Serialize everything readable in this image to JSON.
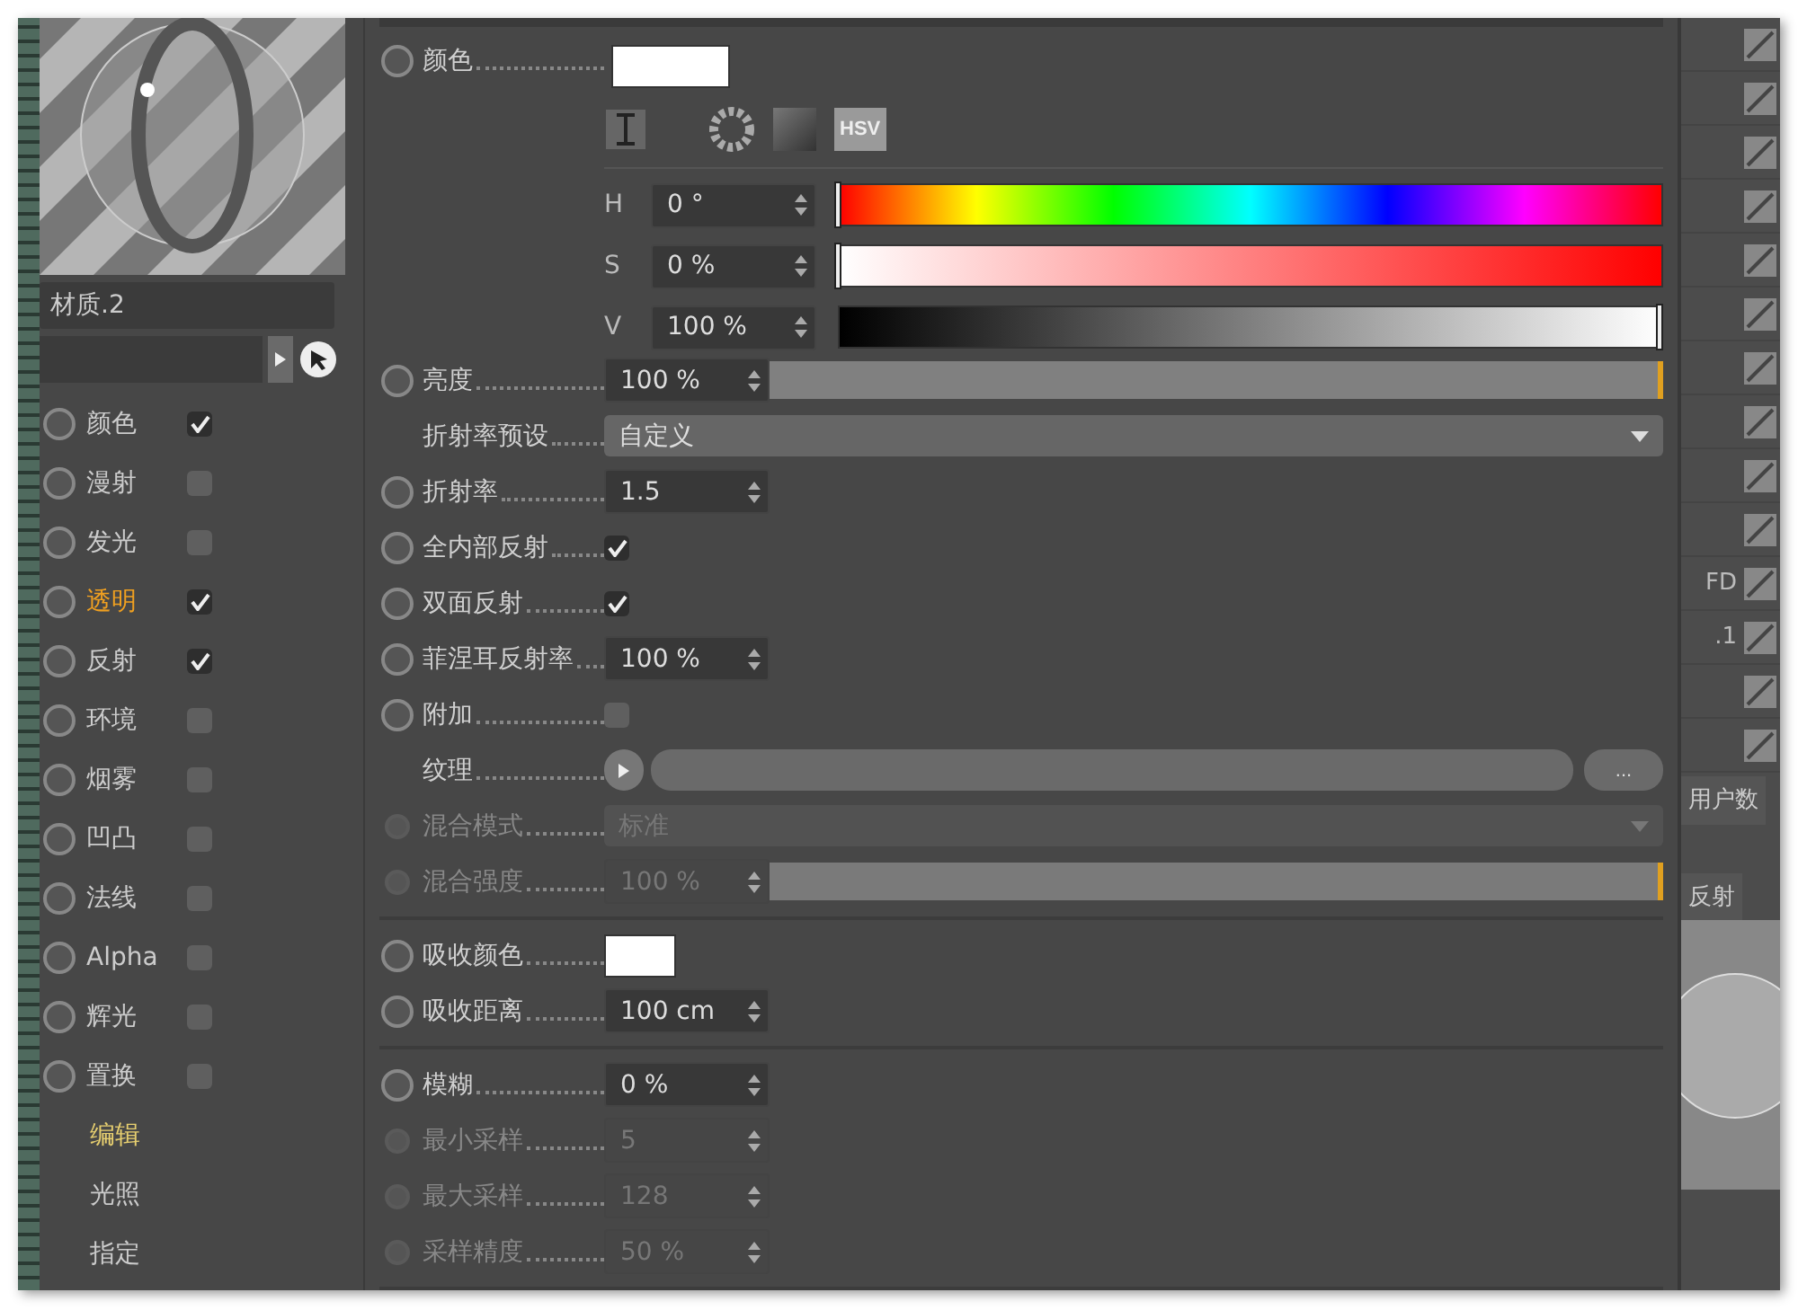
{
  "material": {
    "name": "材质.2"
  },
  "channels": [
    {
      "label": "颜色",
      "checked": true,
      "selected": false
    },
    {
      "label": "漫射",
      "checked": false,
      "selected": false
    },
    {
      "label": "发光",
      "checked": false,
      "selected": false
    },
    {
      "label": "透明",
      "checked": true,
      "selected": true
    },
    {
      "label": "反射",
      "checked": true,
      "selected": false
    },
    {
      "label": "环境",
      "checked": false,
      "selected": false
    },
    {
      "label": "烟雾",
      "checked": false,
      "selected": false
    },
    {
      "label": "凹凸",
      "checked": false,
      "selected": false
    },
    {
      "label": "法线",
      "checked": false,
      "selected": false
    },
    {
      "label": "Alpha",
      "checked": false,
      "selected": false
    },
    {
      "label": "辉光",
      "checked": false,
      "selected": false
    },
    {
      "label": "置换",
      "checked": false,
      "selected": false
    }
  ],
  "pages": [
    {
      "label": "编辑",
      "selected": true
    },
    {
      "label": "光照",
      "selected": false
    },
    {
      "label": "指定",
      "selected": false
    }
  ],
  "sections": [
    {
      "rows": [
        {
          "kind": "color",
          "label": "颜色",
          "radio": true,
          "disabled": false,
          "color": "#ffffff",
          "modes": [
            {
              "label": "HSV",
              "selected": true
            }
          ],
          "channels": [
            {
              "kind": "hue",
              "label": "H",
              "value": "0 °",
              "level": 0
            },
            {
              "kind": "sat",
              "label": "S",
              "value": "0 %",
              "level": 0
            },
            {
              "kind": "val",
              "label": "V",
              "value": "100 %",
              "level": 1
            }
          ]
        },
        {
          "kind": "slider",
          "label": "亮度",
          "radio": true,
          "disabled": false,
          "value": "100 %",
          "level": 1
        },
        {
          "kind": "dropdown",
          "label": "折射率预设",
          "radio": false,
          "disabled": false,
          "value": "自定义"
        },
        {
          "kind": "number",
          "label": "折射率",
          "radio": true,
          "disabled": false,
          "value": "1.5"
        },
        {
          "kind": "checkbox",
          "label": "全内部反射",
          "radio": true,
          "disabled": false,
          "checked": true
        },
        {
          "kind": "checkbox",
          "label": "双面反射",
          "radio": true,
          "disabled": false,
          "checked": true
        },
        {
          "kind": "number",
          "label": "菲涅耳反射率",
          "radio": true,
          "disabled": false,
          "value": "100 %"
        },
        {
          "kind": "checkbox",
          "label": "附加",
          "radio": true,
          "disabled": false,
          "checked": false
        },
        {
          "kind": "texture",
          "label": "纹理",
          "radio": false,
          "disabled": false,
          "button": "..."
        },
        {
          "kind": "dropdown",
          "label": "混合模式",
          "radio": true,
          "disabled": true,
          "value": "标准"
        },
        {
          "kind": "slider",
          "label": "混合强度",
          "radio": true,
          "disabled": true,
          "value": "100 %",
          "level": 1
        }
      ]
    },
    {
      "rows": [
        {
          "kind": "swatch",
          "label": "吸收颜色",
          "radio": true,
          "disabled": false,
          "color": "#ffffff"
        },
        {
          "kind": "number",
          "label": "吸收距离",
          "radio": true,
          "disabled": false,
          "value": "100 cm"
        }
      ]
    },
    {
      "rows": [
        {
          "kind": "number",
          "label": "模糊",
          "radio": true,
          "disabled": false,
          "value": "0 %"
        },
        {
          "kind": "number",
          "label": "最小采样",
          "radio": true,
          "disabled": true,
          "value": "5"
        },
        {
          "kind": "number",
          "label": "最大采样",
          "radio": true,
          "disabled": true,
          "value": "128"
        },
        {
          "kind": "number",
          "label": "采样精度",
          "radio": true,
          "disabled": true,
          "value": "50 %"
        }
      ]
    }
  ],
  "side_panel": {
    "labels": [
      "FD",
      ".1"
    ],
    "tabs": [
      {
        "label": "用户数"
      }
    ],
    "bottom_tabs": [
      {
        "label": "反射"
      }
    ]
  }
}
